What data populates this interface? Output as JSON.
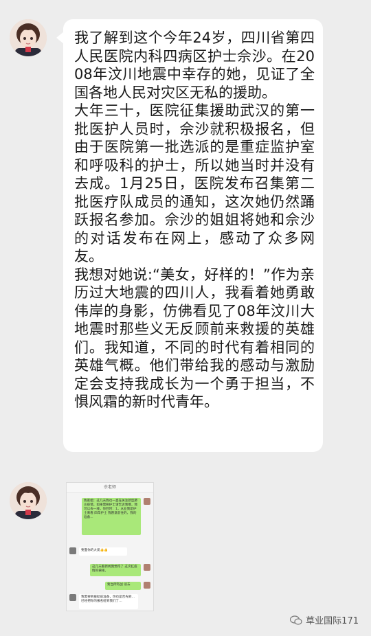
{
  "messages": [
    {
      "type": "text",
      "paragraphs": [
        "我了解到这个今年24岁，四川省第四人民医院内科四病区护士佘沙。在2008年汶川地震中幸存的她，见证了全国各地人民对灾区无私的援助。",
        "大年三十，医院征集援助武汉的第一批医护人员时，佘沙就积极报名，但由于医院第一批选派的是重症监护室和呼吸科的护士，所以她当时并没有去成。1月25日，医院发布召集第二批医疗队成员的通知，这次她仍然踊跃报名参加。佘沙的姐姐将她和佘沙的对话发布在网上，感动了众多网友。",
        "我想对她说:“美女，好样的！”作为亲历过大地震的四川人，我看着她勇敢伟岸的身影，仿佛看见了08年汶川大地震时那些义无反顾前来救援的英雄们。我知道，不同的时代有着相同的英雄气概。他们带给我的感动与激励定会支持我成长为一个勇于担当，不惧风霜的新时代青年。"
      ]
    },
    {
      "type": "image",
      "thumb": {
        "title": "佘老师",
        "bubbles": [
          "我家姐：这几天我也一直在关注新型肺炎疫情，如果需要护士请告诉我哦，我可以去一线，你回时：1，从业我是护士来看 四年护士 我愿意前往的，我的准备...",
          "要面你的大爱👍👍",
          "这几天看新闻我觉得了 这次扛疫情的抉择。",
          "要当所有战 谈去",
          "我需要到援助前准备，你也是否先到…已经把你的报名给到我们了…"
        ]
      }
    }
  ],
  "watermark": "草业国际171"
}
